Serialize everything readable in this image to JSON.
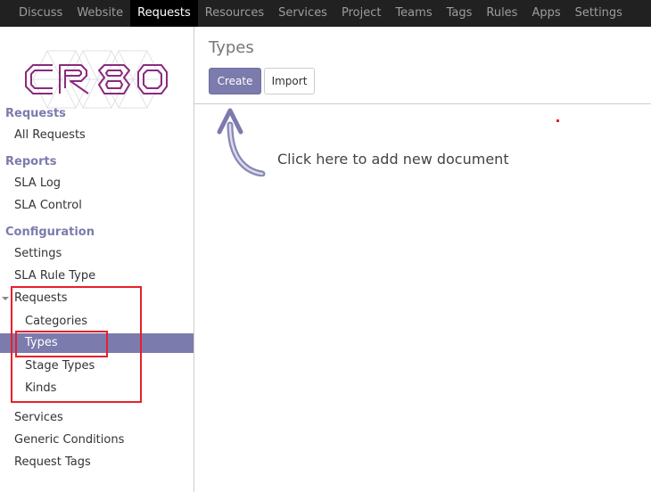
{
  "topnav": {
    "items": [
      {
        "label": "Discuss"
      },
      {
        "label": "Website"
      },
      {
        "label": "Requests"
      },
      {
        "label": "Resources"
      },
      {
        "label": "Services"
      },
      {
        "label": "Project"
      },
      {
        "label": "Teams"
      },
      {
        "label": "Tags"
      },
      {
        "label": "Rules"
      },
      {
        "label": "Apps"
      },
      {
        "label": "Settings"
      }
    ],
    "active": "Requests"
  },
  "sidebar": {
    "logo_text": "CR&O",
    "sections": {
      "requests": "Requests",
      "reports": "Reports",
      "configuration": "Configuration"
    },
    "links": {
      "all_requests": "All Requests",
      "sla_log": "SLA Log",
      "sla_control": "SLA Control",
      "settings": "Settings",
      "sla_rule_type": "SLA Rule Type",
      "requests_group": "Requests",
      "categories": "Categories",
      "types": "Types",
      "stage_types": "Stage Types",
      "kinds": "Kinds",
      "services": "Services",
      "generic_conditions": "Generic Conditions",
      "request_tags": "Request Tags"
    }
  },
  "main": {
    "title": "Types",
    "create_label": "Create",
    "import_label": "Import",
    "hint": "Click here to add new document"
  },
  "colors": {
    "accent": "#7c7bad",
    "topbar": "#212121",
    "highlight": "#e8202a"
  }
}
